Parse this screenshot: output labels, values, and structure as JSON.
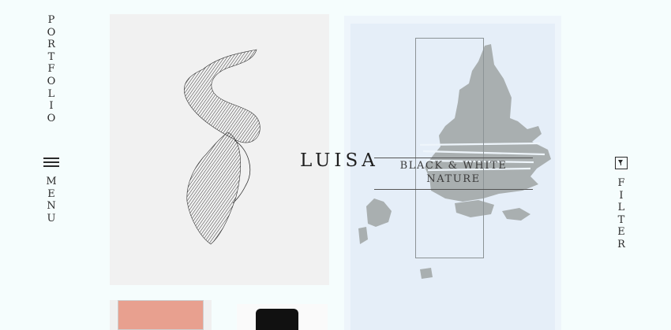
{
  "nav": {
    "portfolio_letters": [
      "P",
      "O",
      "R",
      "T",
      "F",
      "O",
      "L",
      "I",
      "O"
    ],
    "menu_letters": [
      "M",
      "E",
      "N",
      "U"
    ],
    "filter_letters": [
      "F",
      "I",
      "L",
      "T",
      "E",
      "R"
    ]
  },
  "project": {
    "brand": "LUISA",
    "caption_line1": "BLACK & WHITE",
    "caption_line2": "NATURE"
  },
  "colors": {
    "background": "#f5fdfd",
    "text": "#2a2a2a",
    "island_gray": "#a9afb0"
  },
  "icons": {
    "menu": "hamburger-icon",
    "filter": "filter-funnel-icon"
  }
}
